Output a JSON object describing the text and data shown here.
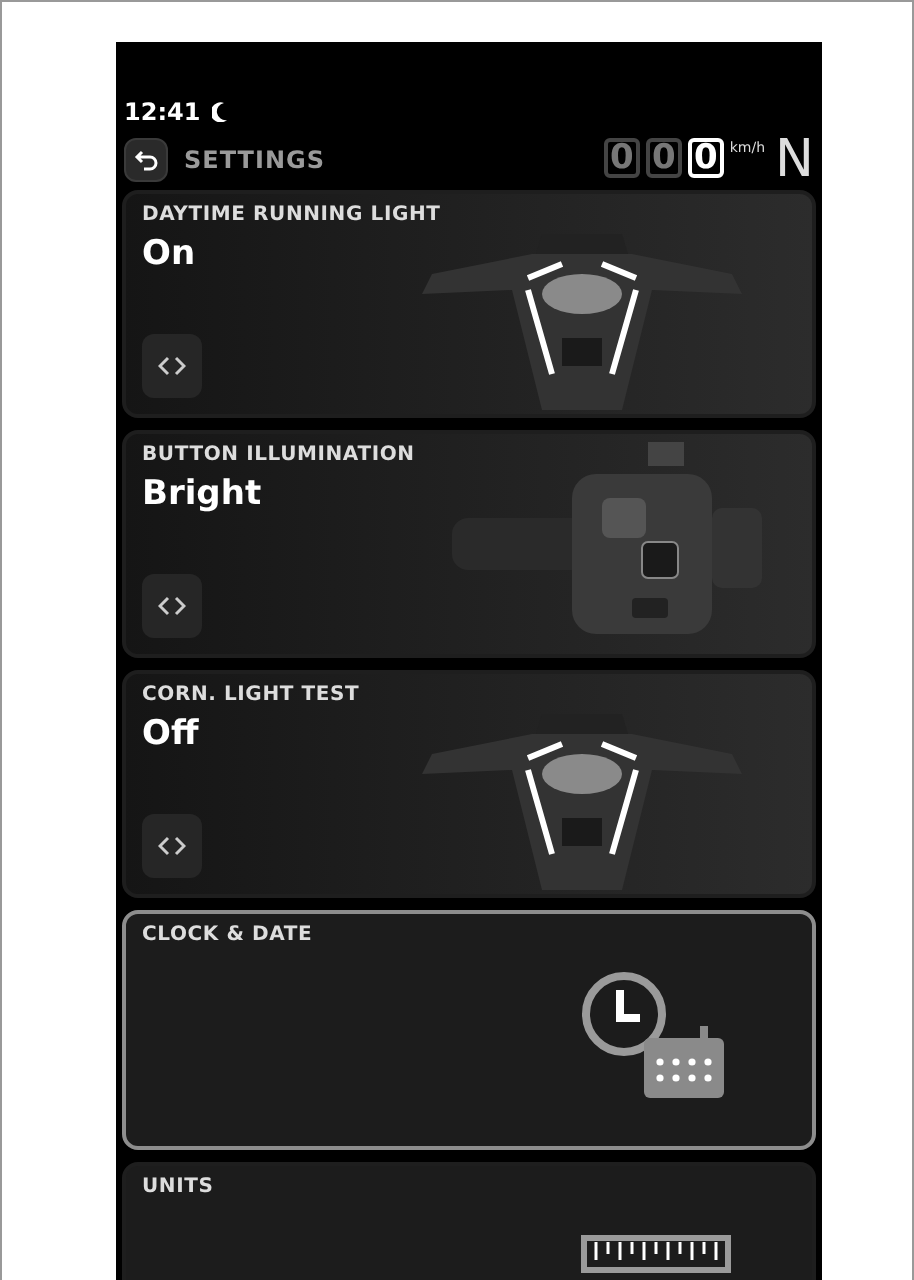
{
  "status": {
    "time": "12:41",
    "night_mode": true
  },
  "header": {
    "title": "SETTINGS",
    "speed_digits": [
      {
        "text": "0",
        "lit": false
      },
      {
        "text": "0",
        "lit": false
      },
      {
        "text": "0",
        "lit": true
      }
    ],
    "speed_unit": "km/h",
    "gear": "N"
  },
  "cards": [
    {
      "kind": "option",
      "title": "DAYTIME RUNNING LIGHT",
      "value": "On",
      "picture": {
        "kind": "front"
      },
      "selected": false
    },
    {
      "kind": "option",
      "title": "BUTTON ILLUMINATION",
      "value": "Bright",
      "picture": {
        "kind": "switch"
      },
      "selected": false
    },
    {
      "kind": "option",
      "title": "CORN. LIGHT TEST",
      "value": "Off",
      "picture": {
        "kind": "front"
      },
      "selected": false
    },
    {
      "kind": "menu",
      "title": "CLOCK & DATE",
      "picture": {
        "kind": "clock"
      },
      "selected": true
    },
    {
      "kind": "menu",
      "title": "UNITS",
      "picture": {
        "kind": "ruler"
      },
      "selected": false
    }
  ]
}
